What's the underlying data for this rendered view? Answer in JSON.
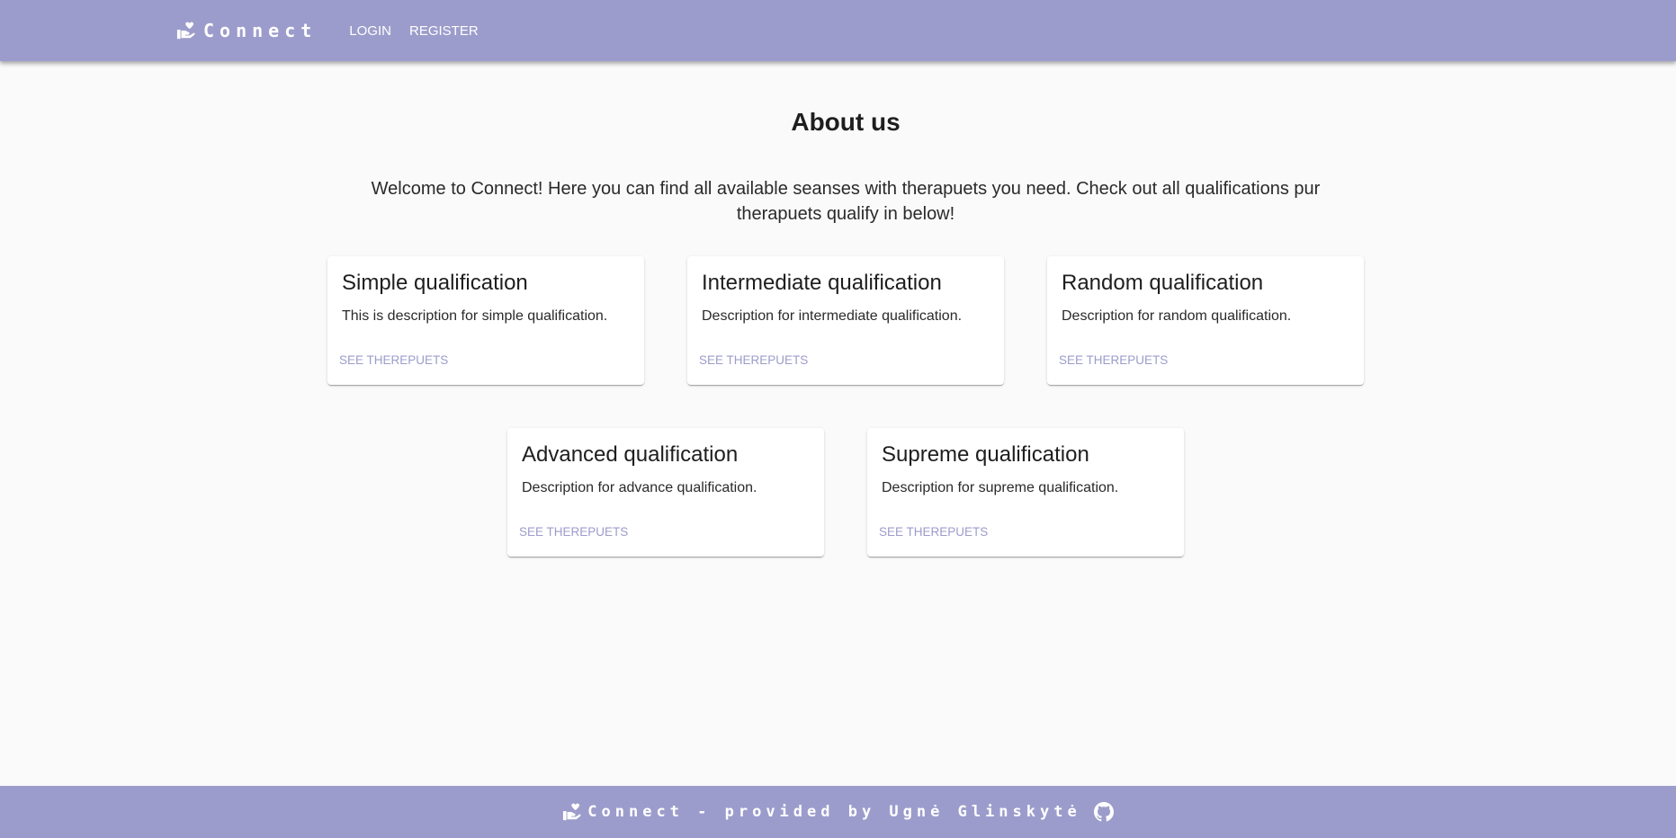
{
  "header": {
    "brand": "Connect",
    "nav": [
      {
        "label": "LOGIN"
      },
      {
        "label": "REGISTER"
      }
    ]
  },
  "main": {
    "title": "About us",
    "intro": "Welcome to Connect! Here you can find all available seanses with therapuets you need. Check out all qualifications pur therapuets qualify in below!",
    "cards": [
      {
        "title": "Simple qualification",
        "description": "This is description for simple qualification.",
        "action": "SEE THEREPUETS"
      },
      {
        "title": "Intermediate qualification",
        "description": "Description for intermediate qualification.",
        "action": "SEE THEREPUETS"
      },
      {
        "title": "Random qualification",
        "description": "Description for random qualification.",
        "action": "SEE THEREPUETS"
      },
      {
        "title": "Advanced qualification",
        "description": "Description for advance qualification.",
        "action": "SEE THEREPUETS"
      },
      {
        "title": "Supreme qualification",
        "description": "Description for supreme qualification.",
        "action": "SEE THEREPUETS"
      }
    ]
  },
  "footer": {
    "text": "Connect - provided by Ugnė Glinskytė",
    "icons": [
      "hand-heart-icon",
      "github-icon"
    ]
  },
  "colors": {
    "accent": "#9c9ccc",
    "background": "#fafafa",
    "text": "#212121"
  },
  "icons": {
    "brand": "hand-heart-icon"
  }
}
